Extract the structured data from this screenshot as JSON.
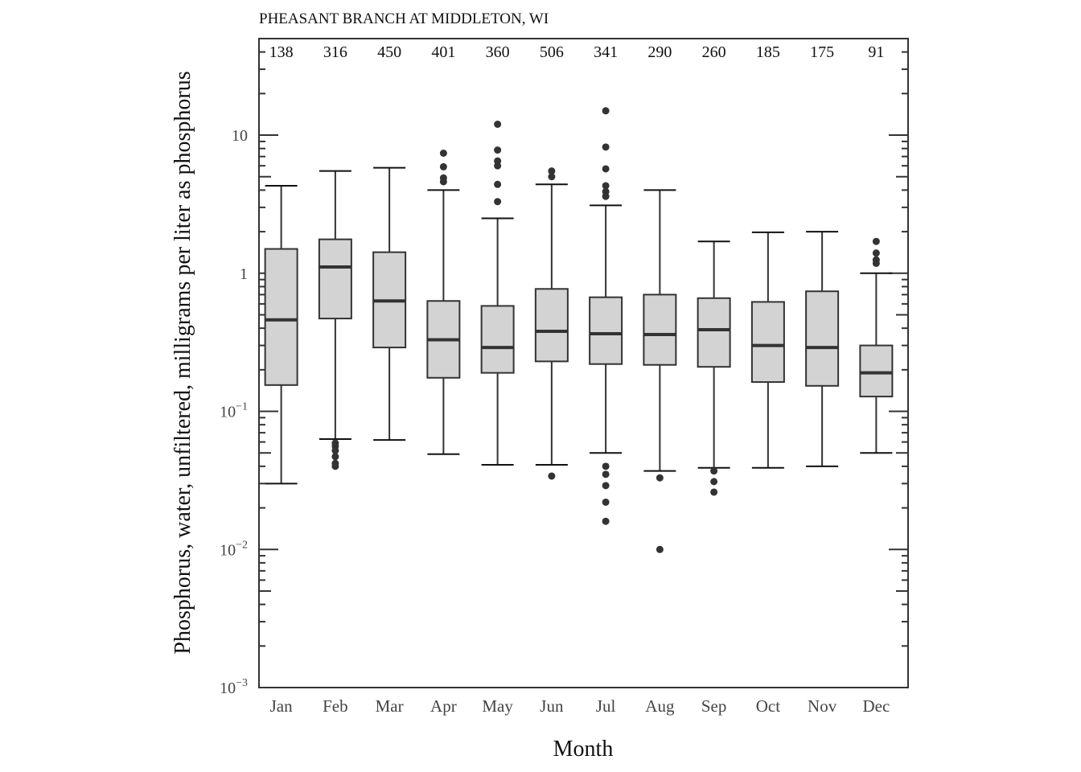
{
  "chart_data": {
    "type": "box",
    "title": "PHEASANT BRANCH AT MIDDLETON, WI",
    "xlabel": "Month",
    "ylabel": "Phosphorus, water, unfiltered, milligrams per liter as phosphorus",
    "yscale": "log",
    "ylim": [
      0.001,
      50
    ],
    "yticks": [
      {
        "value": 10,
        "label": "10",
        "exp": ""
      },
      {
        "value": 1,
        "label": "1",
        "exp": ""
      },
      {
        "value": 0.1,
        "label": "10",
        "exp": "−1"
      },
      {
        "value": 0.01,
        "label": "10",
        "exp": "−2"
      },
      {
        "value": 0.001,
        "label": "10",
        "exp": "−3"
      }
    ],
    "grid": false,
    "colors": {
      "box_fill": "#d3d3d3",
      "box_stroke": "#333333",
      "outlier": "#333333",
      "axis": "#333333"
    },
    "categories": [
      "Jan",
      "Feb",
      "Mar",
      "Apr",
      "May",
      "Jun",
      "Jul",
      "Aug",
      "Sep",
      "Oct",
      "Nov",
      "Dec"
    ],
    "counts": [
      138,
      316,
      450,
      401,
      360,
      506,
      341,
      290,
      260,
      185,
      175,
      91
    ],
    "boxes": [
      {
        "month": "Jan",
        "whisker_low": 0.03,
        "q1": 0.155,
        "median": 0.46,
        "q3": 1.5,
        "whisker_high": 4.3,
        "outliers": []
      },
      {
        "month": "Feb",
        "whisker_low": 0.063,
        "q1": 0.47,
        "median": 1.11,
        "q3": 1.76,
        "whisker_high": 5.5,
        "outliers": [
          0.059,
          0.056,
          0.052,
          0.047,
          0.042,
          0.04
        ]
      },
      {
        "month": "Mar",
        "whisker_low": 0.062,
        "q1": 0.29,
        "median": 0.63,
        "q3": 1.42,
        "whisker_high": 5.8,
        "outliers": []
      },
      {
        "month": "Apr",
        "whisker_low": 0.049,
        "q1": 0.175,
        "median": 0.33,
        "q3": 0.63,
        "whisker_high": 4.0,
        "outliers": [
          7.4,
          5.9,
          4.9,
          4.6
        ]
      },
      {
        "month": "May",
        "whisker_low": 0.041,
        "q1": 0.19,
        "median": 0.29,
        "q3": 0.58,
        "whisker_high": 2.5,
        "outliers": [
          12.0,
          7.8,
          6.5,
          6.0,
          4.4,
          3.3
        ]
      },
      {
        "month": "Jun",
        "whisker_low": 0.041,
        "q1": 0.23,
        "median": 0.38,
        "q3": 0.77,
        "whisker_high": 4.4,
        "outliers": [
          5.5,
          5.0,
          0.034
        ]
      },
      {
        "month": "Jul",
        "whisker_low": 0.05,
        "q1": 0.22,
        "median": 0.365,
        "q3": 0.67,
        "whisker_high": 3.1,
        "outliers": [
          15.0,
          8.2,
          5.7,
          4.3,
          3.9,
          3.6,
          0.04,
          0.035,
          0.029,
          0.022,
          0.016
        ]
      },
      {
        "month": "Aug",
        "whisker_low": 0.037,
        "q1": 0.217,
        "median": 0.36,
        "q3": 0.7,
        "whisker_high": 4.0,
        "outliers": [
          0.033,
          0.01
        ]
      },
      {
        "month": "Sep",
        "whisker_low": 0.039,
        "q1": 0.21,
        "median": 0.39,
        "q3": 0.66,
        "whisker_high": 1.7,
        "outliers": [
          0.037,
          0.031,
          0.026
        ]
      },
      {
        "month": "Oct",
        "whisker_low": 0.039,
        "q1": 0.163,
        "median": 0.3,
        "q3": 0.62,
        "whisker_high": 1.98,
        "outliers": []
      },
      {
        "month": "Nov",
        "whisker_low": 0.04,
        "q1": 0.153,
        "median": 0.29,
        "q3": 0.74,
        "whisker_high": 2.0,
        "outliers": []
      },
      {
        "month": "Dec",
        "whisker_low": 0.05,
        "q1": 0.128,
        "median": 0.19,
        "q3": 0.3,
        "whisker_high": 1.0,
        "outliers": [
          1.7,
          1.4,
          1.25,
          1.18
        ]
      }
    ]
  }
}
